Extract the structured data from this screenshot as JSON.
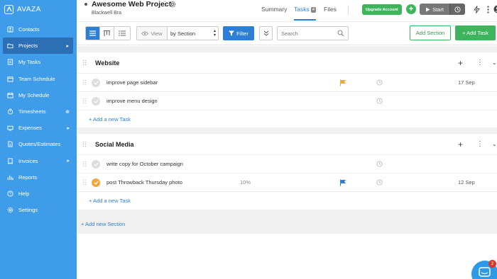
{
  "app": {
    "brand": "AVAZA"
  },
  "sidebar": {
    "items": [
      {
        "label": "Contacts",
        "icon": "contacts-icon",
        "trail": ""
      },
      {
        "label": "Projects",
        "icon": "folder-icon",
        "trail": "▸",
        "active": true
      },
      {
        "label": "My Tasks",
        "icon": "tasks-icon",
        "trail": ""
      },
      {
        "label": "Team Schedule",
        "icon": "team-schedule-icon",
        "trail": ""
      },
      {
        "label": "My Schedule",
        "icon": "calendar-icon",
        "trail": ""
      },
      {
        "label": "Timesheets",
        "icon": "stopwatch-icon",
        "trail": "⊕"
      },
      {
        "label": "Expenses",
        "icon": "expenses-icon",
        "trail": "▸"
      },
      {
        "label": "Quotes/Estimates",
        "icon": "quotes-icon",
        "trail": ""
      },
      {
        "label": "Invoices",
        "icon": "invoices-icon",
        "trail": "▸"
      },
      {
        "label": "Reports",
        "icon": "reports-icon",
        "trail": ""
      },
      {
        "label": "Help",
        "icon": "help-icon",
        "trail": ""
      },
      {
        "label": "Settings",
        "icon": "settings-icon",
        "trail": ""
      }
    ]
  },
  "header": {
    "project_title": "Awesome Web Project",
    "project_more": "⋮",
    "project_sub": "Blackwell Bra",
    "tabs": {
      "summary": "Summary",
      "tasks": "Tasks",
      "tasks_count": "4",
      "files": "Files"
    },
    "upgrade_label": "Upgrade Account",
    "plus_label": "+",
    "start_label": "Start"
  },
  "toolbar": {
    "view_label": "View",
    "group_by": "by Section",
    "filter_label": "Filter",
    "search_placeholder": "Search",
    "add_section_label": "Add Section",
    "add_task_label": "+ Add Task"
  },
  "sections": [
    {
      "title": "Website",
      "tasks": [
        {
          "name": "improve page sidebar",
          "flag": true,
          "flag_color": "#f0a83c",
          "date": "17 Sep",
          "pct": "",
          "done": false
        },
        {
          "name": "improve menu design",
          "flag": false,
          "date": "",
          "pct": "",
          "done": false
        }
      ],
      "add_task_link": "+ Add a new Task"
    },
    {
      "title": "Social Media",
      "tasks": [
        {
          "name": "write copy for October campaign",
          "flag": false,
          "date": "",
          "pct": "",
          "done": false
        },
        {
          "name": "post Throwback Thursday photo",
          "flag": true,
          "flag_color": "#2d7fd6",
          "date": "12 Sep",
          "pct": "10%",
          "done": true
        }
      ],
      "add_task_link": "+ Add a new Task"
    }
  ],
  "add_new_section": "+ Add new Section",
  "chat": {
    "badge": "2"
  },
  "colors": {
    "sidebar": "#3f9ce8",
    "accent": "#2d7fd6",
    "green": "#3eb55c",
    "orange": "#f0a83c"
  }
}
